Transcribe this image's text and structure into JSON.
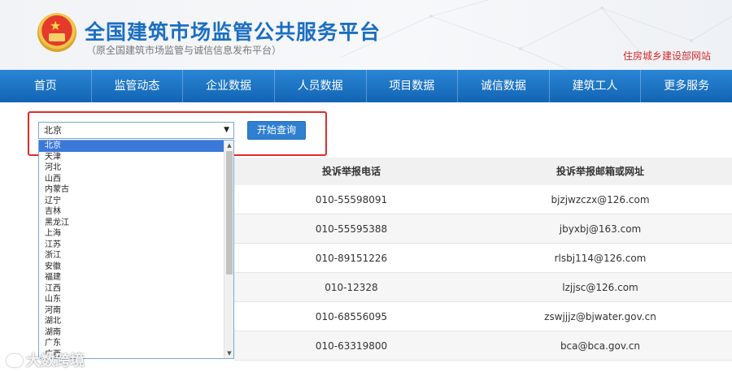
{
  "header": {
    "title": "全国建筑市场监管公共服务平台",
    "subtitle": "（原全国建筑市场监管与诚信信息发布平台）",
    "ministry_link": "住房城乡建设部网站"
  },
  "nav": {
    "items": [
      "首页",
      "监管动态",
      "企业数据",
      "人员数据",
      "项目数据",
      "诚信数据",
      "建筑工人",
      "更多服务"
    ]
  },
  "query": {
    "selected_province": "北京",
    "button_label": "开始查询"
  },
  "dropdown": {
    "options": [
      "北京",
      "天津",
      "河北",
      "山西",
      "内蒙古",
      "辽宁",
      "吉林",
      "黑龙江",
      "上海",
      "江苏",
      "浙江",
      "安徽",
      "福建",
      "江西",
      "山东",
      "河南",
      "湖北",
      "湖南",
      "广东",
      "广西"
    ]
  },
  "table": {
    "headers": {
      "phone": "投诉举报电话",
      "email": "投诉举报邮箱或网址"
    },
    "rows": [
      {
        "phone": "010-55598091",
        "email": "bjzjwzczx@126.com"
      },
      {
        "phone": "010-55595388",
        "email": "jbyxbj@163.com"
      },
      {
        "phone": "010-89151226",
        "email": "rlsbj114@126.com"
      },
      {
        "phone": "010-12328",
        "email": "lzjjsc@126.com"
      },
      {
        "phone": "010-68556095",
        "email": "zswjjjz@bjwater.gov.cn"
      },
      {
        "phone": "010-63319800",
        "email": "bca@bca.gov.cn"
      }
    ]
  },
  "watermark": {
    "text": "大数跨境"
  },
  "colors": {
    "brand_blue": "#1b6ec2",
    "nav_blue": "#1a72c4",
    "highlight_red": "#e02b2b",
    "selected_option": "#3b78d8"
  }
}
